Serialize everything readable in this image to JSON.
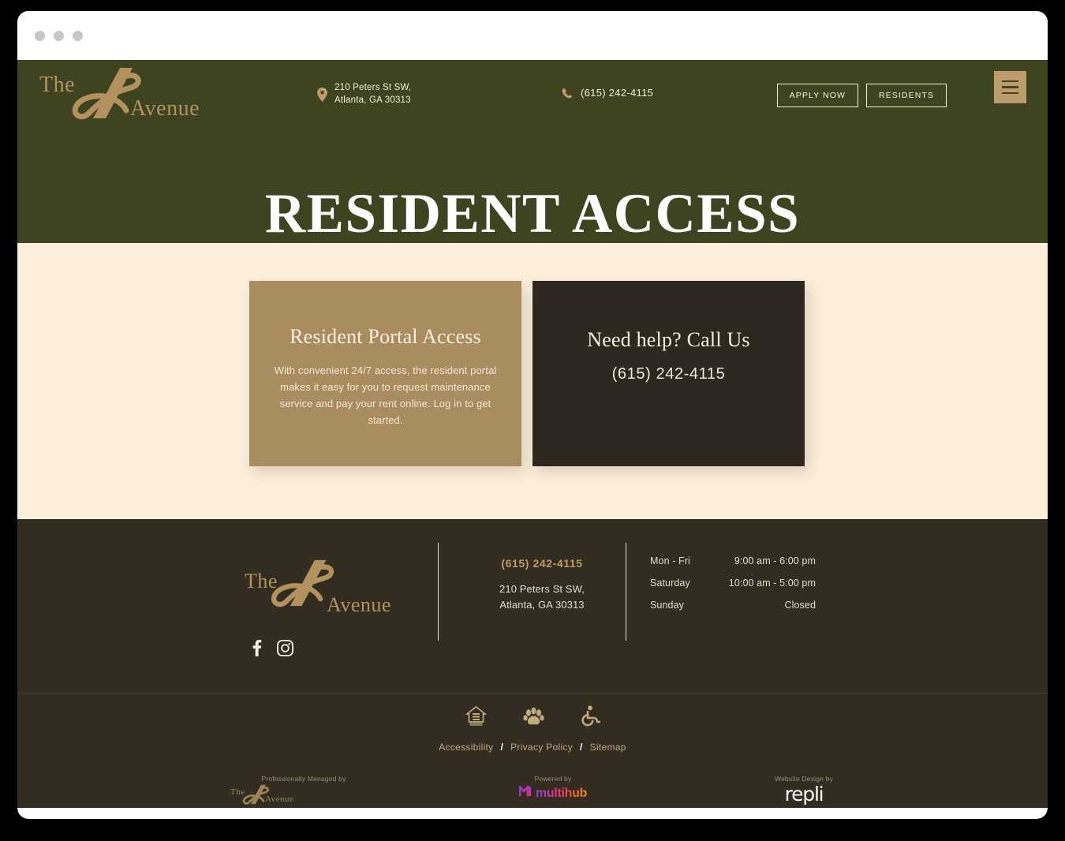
{
  "browser": {
    "dots": [
      "dot-red",
      "dot-yellow",
      "dot-green"
    ]
  },
  "theme": {
    "header_green": "#3F4420",
    "cream": "#FBEFDC",
    "tan": "#A98C5F",
    "gold": "#B3915F",
    "dark_brown": "#2E2820",
    "footer_brown": "#322C21"
  },
  "header": {
    "logo": {
      "the": "The",
      "avenue": "Avenue"
    },
    "address": "210 Peters St SW,\nAtlanta, GA 30313",
    "phone": "(615) 242-4115",
    "apply_label": "APPLY NOW",
    "residents_label": "RESIDENTS",
    "menu_label": "Menu"
  },
  "hero": {
    "title": "RESIDENT ACCESS"
  },
  "cards": [
    {
      "id": "resident-portal",
      "title": "Resident Portal Access",
      "body": "With convenient 24/7 access, the resident portal makes it easy for you to request maintenance service and pay your rent online. Log in to get started."
    },
    {
      "id": "need-help",
      "title": "Need help? Call Us",
      "body": "(615) 242-4115"
    }
  ],
  "footer": {
    "logo": {
      "the": "The",
      "avenue": "Avenue"
    },
    "socials": [
      {
        "name": "facebook",
        "label": "Facebook"
      },
      {
        "name": "instagram",
        "label": "Instagram"
      }
    ],
    "phone": "(615) 242-4115",
    "address": "210 Peters St SW,\nAtlanta, GA 30313",
    "hours": [
      {
        "days": "Mon - Fri",
        "time": "9:00 am - 6:00 pm"
      },
      {
        "days": "Saturday",
        "time": "10:00 am - 5:00 pm"
      },
      {
        "days": "Sunday",
        "time": "Closed"
      }
    ],
    "badges": [
      {
        "name": "equal-housing",
        "label": "Equal Housing Opportunity"
      },
      {
        "name": "pet-friendly",
        "label": "Pet Friendly"
      },
      {
        "name": "accessibility",
        "label": "Accessible"
      }
    ],
    "legal_links": [
      {
        "label": "Accessibility"
      },
      {
        "label": "Privacy Policy"
      },
      {
        "label": "Sitemap"
      }
    ],
    "legal_separator": "/",
    "credits": {
      "managed_label": "Professionally Managed by",
      "managed_logo": {
        "the": "The",
        "avenue": "Avenue"
      },
      "powered_label": "Powered by",
      "powered_name": "multihub",
      "design_label": "Website Design by",
      "design_name": "repli"
    }
  }
}
